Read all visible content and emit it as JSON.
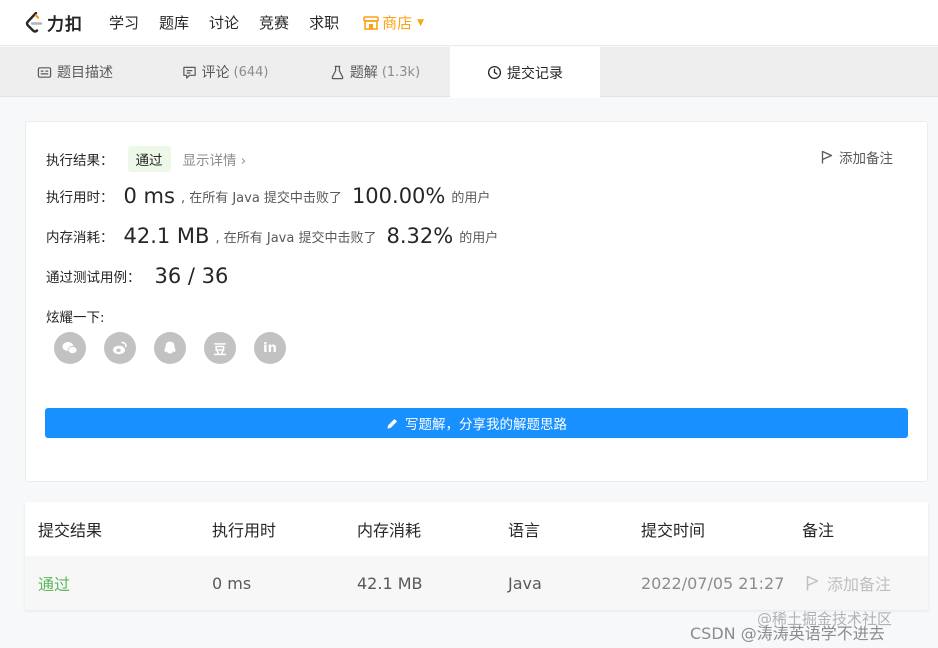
{
  "nav": {
    "logo_text": "力扣",
    "items": [
      "学习",
      "题库",
      "讨论",
      "竞赛",
      "求职"
    ],
    "shop_label": "商店",
    "shop_color": "#ffa116"
  },
  "tabs": [
    {
      "label": "题目描述",
      "count": "",
      "icon": "description-icon"
    },
    {
      "label": "评论",
      "count": "(644)",
      "icon": "comment-icon"
    },
    {
      "label": "题解",
      "count": "(1.3k)",
      "icon": "flask-icon"
    },
    {
      "label": "提交记录",
      "count": "",
      "icon": "clock-icon",
      "active": true
    }
  ],
  "result": {
    "status_label": "执行结果：",
    "status_value": "通过",
    "detail_link": "显示详情 ›",
    "add_note": "添加备注",
    "runtime_label": "执行用时：",
    "runtime_value": "0 ms",
    "runtime_mid": ", 在所有 Java 提交中击败了",
    "runtime_pct": "100.00%",
    "runtime_tail": "的用户",
    "memory_label": "内存消耗：",
    "memory_value": "42.1 MB",
    "memory_mid": ", 在所有 Java 提交中击败了",
    "memory_pct": "8.32%",
    "memory_tail": "的用户",
    "tests_label": "通过测试用例：",
    "tests_value": "36 / 36",
    "share_label": "炫耀一下:",
    "share_icons": [
      "wechat-icon",
      "weibo-icon",
      "qq-icon",
      "douban-icon",
      "linkedin-icon"
    ],
    "douban_glyph": "豆",
    "linkedin_glyph": "in",
    "write_button": "写题解，分享我的解题思路",
    "accent_color": "#1890ff"
  },
  "table": {
    "headers": [
      "提交结果",
      "执行用时",
      "内存消耗",
      "语言",
      "提交时间",
      "备注"
    ],
    "rows": [
      {
        "status": "通过",
        "runtime": "0 ms",
        "memory": "42.1 MB",
        "language": "Java",
        "time": "2022/07/05 21:27",
        "note": "添加备注"
      }
    ],
    "pass_color": "#5cb85c"
  },
  "watermark": {
    "line1": "@稀土掘金技术社区",
    "line2": "CSDN @涛涛英语学不进去"
  }
}
